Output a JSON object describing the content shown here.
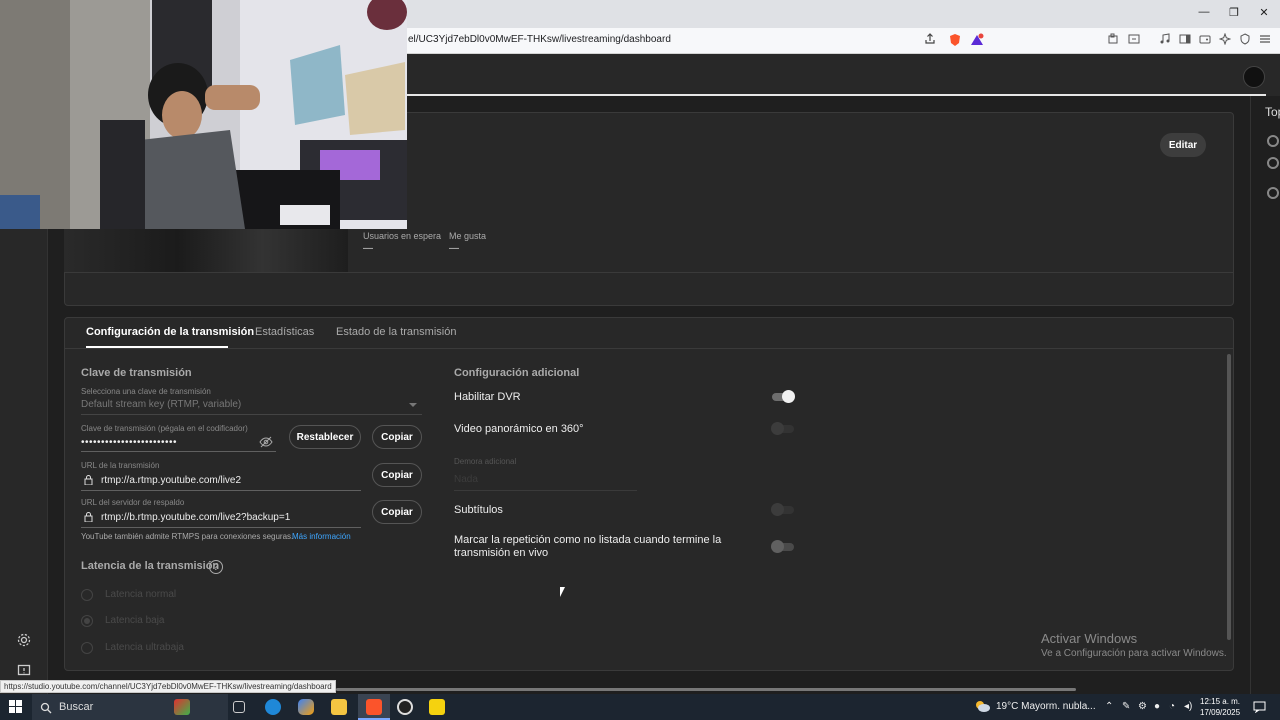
{
  "browser": {
    "url": "el/UC3Yjd7ebDl0v0MwEF-THKsw/livestreaming/dashboard",
    "window_controls": [
      "—",
      "❐",
      "✕"
    ],
    "status_url": "https://studio.youtube.com/channel/UC3Yjd7ebDl0v0MwEF-THKsw/livestreaming/dashboard"
  },
  "right_panel": {
    "label": "Top"
  },
  "stream_card": {
    "edit_label": "Editar",
    "stats": [
      {
        "label": "Usuarios en espera",
        "value": "—"
      },
      {
        "label": "Me gusta",
        "value": "—"
      }
    ]
  },
  "tabs": [
    {
      "label": "Configuración de la transmisión",
      "active": true
    },
    {
      "label": "Estadísticas",
      "active": false
    },
    {
      "label": "Estado de la transmisión",
      "active": false
    }
  ],
  "stream_key": {
    "title": "Clave de transmisión",
    "select_caption": "Selecciona una clave de transmisión",
    "select_value": "Default stream key (RTMP, variable)",
    "key_caption": "Clave de transmisión (pégala en el codificador)",
    "key_value": "••••••••••••••••••••••••",
    "reset_label": "Restablecer",
    "copy_label": "Copiar",
    "url_caption": "URL de la transmisión",
    "url_value": "rtmp://a.rtmp.youtube.com/live2",
    "backup_caption": "URL del servidor de respaldo",
    "backup_value": "rtmp://b.rtmp.youtube.com/live2?backup=1",
    "rtmps_note": "YouTube también admite RTMPS para conexiones seguras.",
    "more_info": "Más información"
  },
  "latency": {
    "title": "Latencia de la transmisión",
    "help_icon": "?",
    "options": [
      {
        "label": "Latencia normal",
        "selected": false
      },
      {
        "label": "Latencia baja",
        "selected": true
      },
      {
        "label": "Latencia ultrabaja",
        "selected": false
      }
    ]
  },
  "additional": {
    "title": "Configuración adicional",
    "dvr_label": "Habilitar DVR",
    "dvr_on": true,
    "pano_label": "Video panorámico en 360°",
    "pano_on": false,
    "delay_caption": "Demora adicional",
    "delay_value": "Nada",
    "subtitles_label": "Subtítulos",
    "subtitles_on": false,
    "unlisted_label_line1": "Marcar la repetición como no listada cuando termine la",
    "unlisted_label_line2": "transmisión en vivo",
    "unlisted_on": false
  },
  "watermark": {
    "title": "Activar Windows",
    "subtitle": "Ve a Configuración para activar Windows."
  },
  "taskbar": {
    "search_label": "Buscar",
    "weather": "19°C  Mayorm. nubla...",
    "time": "12:15 a. m.",
    "date": "17/09/2025"
  },
  "colors": {
    "studio_bg": "#1f1f1f",
    "card_bg": "#282828",
    "link": "#3ea6ff",
    "taskbar": "#1c2530"
  }
}
